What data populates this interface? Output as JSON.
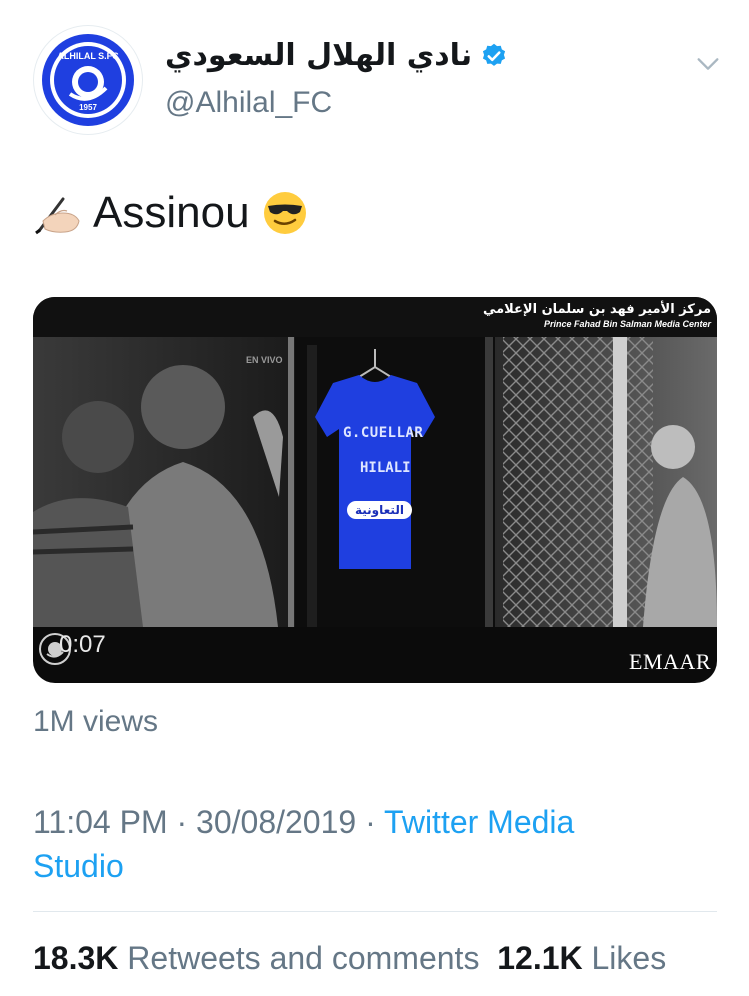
{
  "tweet": {
    "author": {
      "display_name": "نادي الهلال السعودي",
      "handle": "@Alhilal_FC",
      "verified": true,
      "avatar": {
        "logo_text": "ALHILAL S.FC",
        "year": "1957"
      }
    },
    "text": "Assinou",
    "emojis": {
      "leading": "writing-hand",
      "trailing": "smiling-face-with-sunglasses"
    },
    "media": {
      "type": "video",
      "watermark_ar": "مركز الأمير فهد بن سلمان الإعلامي",
      "watermark_en": "Prince Fahad Bin Salman Media Center",
      "overlay_label": "EN VIVO",
      "jersey_name": "G.CUELLAR",
      "jersey_sub": "HILALI",
      "jersey_sponsor": "التعاونية",
      "duration": "0:07",
      "brand": "EMAAR"
    },
    "views": "1M views",
    "time": "11:04 PM",
    "date": "30/08/2019",
    "separator": "·",
    "source": "Twitter Media Studio",
    "stats": {
      "retweets_count": "18.3K",
      "retweets_label": "Retweets and comments",
      "likes_count": "12.1K",
      "likes_label": "Likes"
    }
  },
  "colors": {
    "verified_blue": "#1da1f2",
    "link_blue": "#1da1f2",
    "secondary_text": "#657786",
    "primary_text": "#14171a",
    "jersey_blue": "#1f3fe0"
  },
  "icons": [
    "verified-badge-icon",
    "chevron-down-icon",
    "writing-hand-icon",
    "sunglasses-emoji-icon"
  ]
}
